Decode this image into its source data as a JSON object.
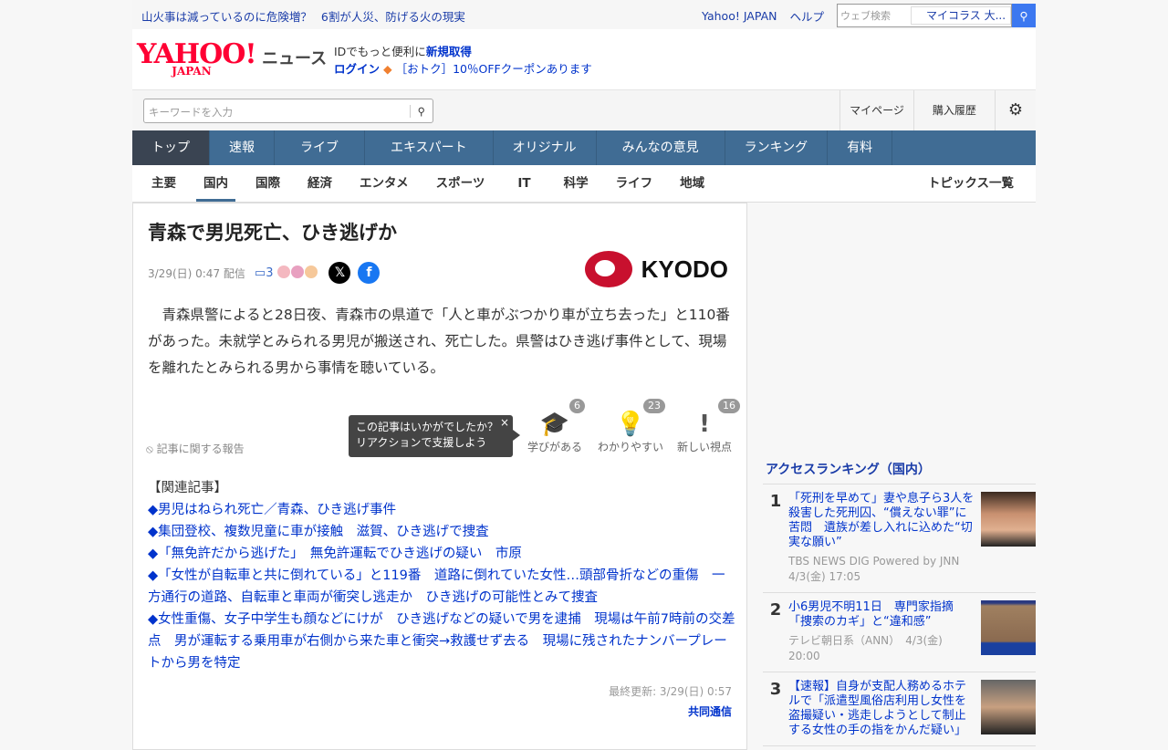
{
  "topbar": {
    "links": [
      "山火事は減っているのに危険増？",
      "6割が人災、防げる火の現実"
    ],
    "yahoo": "Yahoo! JAPAN",
    "help": "ヘルプ",
    "search_placeholder": "ウェブ検索",
    "search_select": "マイコラス 大..."
  },
  "header": {
    "logo": "YAHOO! JAPAN",
    "service": "ニュース",
    "id_text": "IDでもっと便利に",
    "signup": "新規取得",
    "login": "ログイン",
    "coupon": "［おトク］10％OFFクーポンあります"
  },
  "searchbar": {
    "placeholder": "キーワードを入力",
    "mypage": "マイページ",
    "history": "購入履歴"
  },
  "nav": [
    "トップ",
    "速報",
    "ライブ",
    "エキスパート",
    "オリジナル",
    "みんなの意見",
    "ランキング",
    "有料"
  ],
  "subnav": [
    "主要",
    "国内",
    "国際",
    "経済",
    "エンタメ",
    "スポーツ",
    "IT",
    "科学",
    "ライフ",
    "地域"
  ],
  "subnav_all": "トピックス一覧",
  "article": {
    "title": "青森で男児死亡、ひき逃げか",
    "date": "3/29(日) 0:47 配信",
    "comments": "3",
    "source_logo": "KYODO",
    "body": "　青森県警によると28日夜、青森市の県道で「人と車がぶつかり車が立ち去った」と110番があった。未就学とみられる男児が搬送され、死亡した。県警はひき逃げ事件として、現場を離れたとみられる男から事情を聴いている。",
    "report": "記事に関する報告",
    "tooltip": [
      "この記事はいかがでしたか？",
      "リアクションで支援しよう"
    ],
    "reactions": [
      {
        "label": "学びがある",
        "count": "6"
      },
      {
        "label": "わかりやすい",
        "count": "23"
      },
      {
        "label": "新しい視点",
        "count": "16"
      }
    ],
    "related_heading": "【関連記事】",
    "related": [
      "◆男児はねられ死亡／青森、ひき逃げ事件",
      "◆集団登校、複数児童に車が接触　滋賀、ひき逃げで捜査",
      "◆「無免許だから逃げた」　無免許運転でひき逃げの疑い　市原",
      "◆「女性が自転車と共に倒れている」と119番　道路に倒れていた女性…頭部骨折などの重傷　一方通行の道路、自転車と車両が衝突し逃走か　ひき逃げの可能性とみて捜査",
      "◆女性重傷、女子中学生も顔などにけが　ひき逃げなどの疑いで男を逮捕　現場は午前7時前の交差点　男が運転する乗用車が右側から来た車と衝突→救護せず去る　現場に残されたナンバープレートから男を特定"
    ],
    "updated": "最終更新: 3/29(日) 0:57",
    "publisher": "共同通信"
  },
  "ranking": {
    "title": "アクセスランキング（国内）",
    "items": [
      {
        "rank": "1",
        "title": "「死刑を早めて」妻や息子ら3人を殺害した死刑囚、“償えない罪”に苦悶　遺族が差し入れに込めた“切実な願い”",
        "source": "TBS NEWS DIG Powered by JNN",
        "time": "4/3(金) 17:05"
      },
      {
        "rank": "2",
        "title": "小6男児不明11日　専門家指摘「捜索のカギ」と“違和感”",
        "source": "テレビ朝日系（ANN）",
        "time": "4/3(金) 20:00"
      },
      {
        "rank": "3",
        "title": "【速報】自身が支配人務めるホテルで「派遣型風俗店利用し女性を盗撮疑い・逃走しようとして制止する女性の手の指をかんだ疑い」",
        "source": "",
        "time": ""
      }
    ]
  }
}
